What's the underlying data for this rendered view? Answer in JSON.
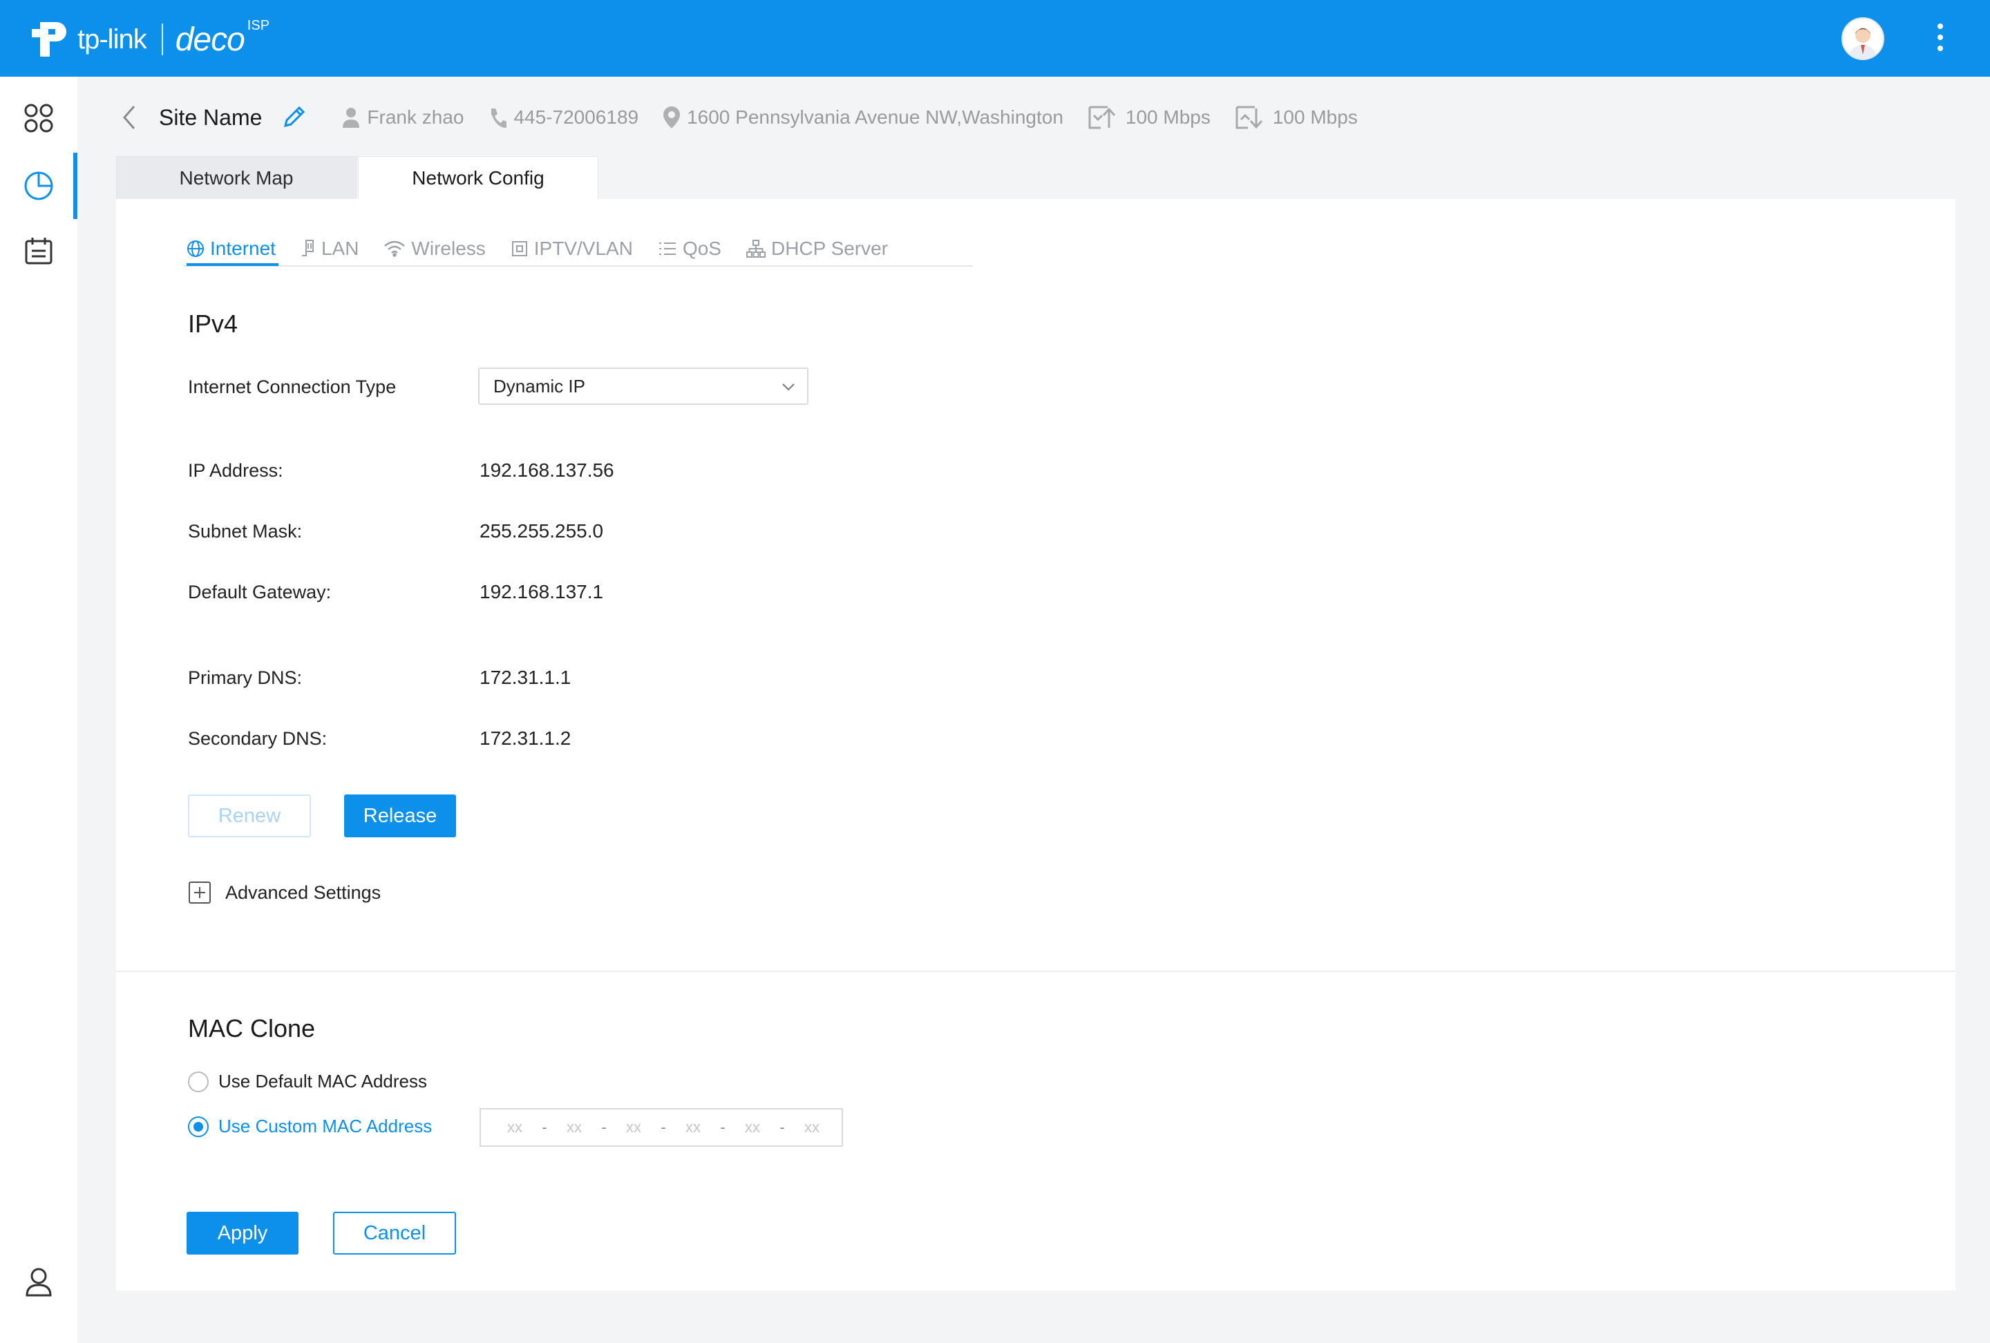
{
  "brand": {
    "logo_text": "tp-link",
    "product": "deco",
    "product_sup": "ISP"
  },
  "header": {
    "site_name": "Site Name",
    "contact_name": "Frank zhao",
    "phone": "445-72006189",
    "address": "1600 Pennsylvania Avenue NW,Washington",
    "upload_speed": "100 Mbps",
    "download_speed": "100 Mbps"
  },
  "tabs": [
    {
      "label": "Network Map",
      "active": false
    },
    {
      "label": "Network Config",
      "active": true
    }
  ],
  "subtabs": [
    {
      "label": "Internet",
      "icon": "globe-icon",
      "active": true
    },
    {
      "label": "LAN",
      "icon": "ethernet-icon",
      "active": false
    },
    {
      "label": "Wireless",
      "icon": "wifi-icon",
      "active": false
    },
    {
      "label": "IPTV/VLAN",
      "icon": "iptv-icon",
      "active": false
    },
    {
      "label": "QoS",
      "icon": "list-icon",
      "active": false
    },
    {
      "label": "DHCP Server",
      "icon": "network-tree-icon",
      "active": false
    }
  ],
  "ipv4": {
    "title": "IPv4",
    "connection_type_label": "Internet Connection Type",
    "connection_type_value": "Dynamic IP",
    "ip_label": "IP Address:",
    "ip_value": "192.168.137.56",
    "mask_label": "Subnet Mask:",
    "mask_value": "255.255.255.0",
    "gateway_label": "Default Gateway:",
    "gateway_value": "192.168.137.1",
    "dns1_label": "Primary DNS:",
    "dns1_value": "172.31.1.1",
    "dns2_label": "Secondary DNS:",
    "dns2_value": "172.31.1.2",
    "renew_label": "Renew",
    "release_label": "Release",
    "advanced_label": "Advanced Settings"
  },
  "mac_clone": {
    "title": "MAC Clone",
    "default_label": "Use Default MAC Address",
    "custom_label": "Use Custom MAC Address",
    "selected": "custom",
    "placeholder_segments": [
      "xx",
      "xx",
      "xx",
      "xx",
      "xx",
      "xx"
    ],
    "separator": "-"
  },
  "actions": {
    "apply_label": "Apply",
    "cancel_label": "Cancel"
  },
  "colors": {
    "accent": "#0c90ea",
    "sidebar_bg": "#ffffff",
    "page_bg": "#f3f4f6"
  }
}
